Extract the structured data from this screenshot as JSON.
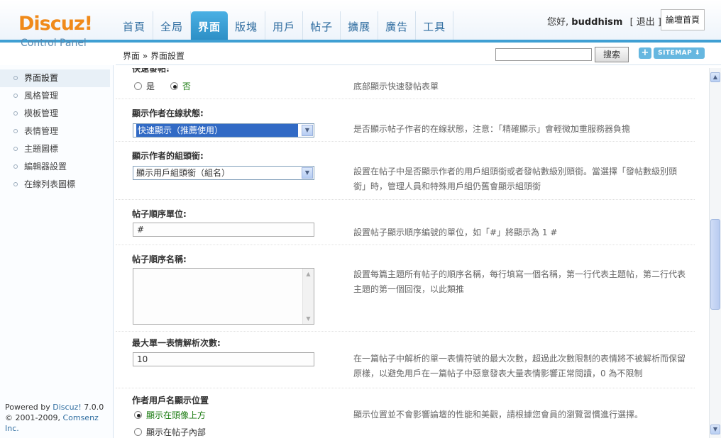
{
  "header": {
    "logo_brand": "Discuz!",
    "logo_sub": "Control Panel",
    "nav": [
      "首頁",
      "全局",
      "界面",
      "版塊",
      "用戶",
      "帖子",
      "擴展",
      "廣告",
      "工具"
    ],
    "active_nav": "界面",
    "greeting": "您好,",
    "username": "buddhism",
    "logout": "[ 退出 ]",
    "forum_home": "論壇首頁"
  },
  "subbar": {
    "breadcrumb": "界面 » 界面設置",
    "search_button": "搜索",
    "plus_icon": "+",
    "sitemap": "SITEMAP ⬇"
  },
  "sidebar": {
    "items": [
      "界面設置",
      "風格管理",
      "模板管理",
      "表情管理",
      "主題圖標",
      "編輯器設置",
      "在線列表圖標"
    ],
    "active": "界面設置"
  },
  "footer": {
    "powered_prefix": "Powered by ",
    "powered_link": "Discuz!",
    "version": " 7.0.0",
    "copyright_prefix": "© 2001-2009, ",
    "company": "Comsenz Inc."
  },
  "settings": {
    "quick_reply": {
      "label": "快速發帖:",
      "options": [
        "是",
        "否"
      ],
      "selected": "否",
      "desc": "底部顯示快速發帖表單"
    },
    "online_status": {
      "label": "顯示作者在線狀態:",
      "value": "快速顯示（推薦使用）",
      "desc": "是否顯示帖子作者的在線狀態，注意：「精確顯示」會輕微加重服務器負擔"
    },
    "group_title": {
      "label": "顯示作者的組頭銜:",
      "value": "顯示用戶組頭銜（組名）",
      "desc": "設置在帖子中是否顯示作者的用戶組頭銜或者發帖數級別頭銜。當選擇「發帖數級別頭銜」時，管理人員和特殊用戶組仍舊會顯示組頭銜"
    },
    "post_unit": {
      "label": "帖子順序單位:",
      "value": "#",
      "desc": "設置帖子顯示順序編號的單位，如「#」將顯示為 1 #"
    },
    "post_names": {
      "label": "帖子順序名稱:",
      "value": "",
      "desc": "設置每篇主題所有帖子的順序名稱，每行填寫一個名稱，第一行代表主題帖，第二行代表主題的第一個回復，以此類推"
    },
    "smiley_max": {
      "label": "最大單一表情解析次數:",
      "value": "10",
      "desc": "在一篇帖子中解析的單一表情符號的最大次數，超過此次數限制的表情將不被解析而保留原樣，以避免用戶在一篇帖子中惡意發表大量表情影響正常閱讀，0 為不限制"
    },
    "author_pos": {
      "label": "作者用戶名顯示位置",
      "options": [
        "顯示在頭像上方",
        "顯示在帖子內部"
      ],
      "selected": "顯示在頭像上方",
      "desc": "顯示位置並不會影響論壇的性能和美觀，請根據您會員的瀏覽習慣進行選擇。"
    }
  }
}
